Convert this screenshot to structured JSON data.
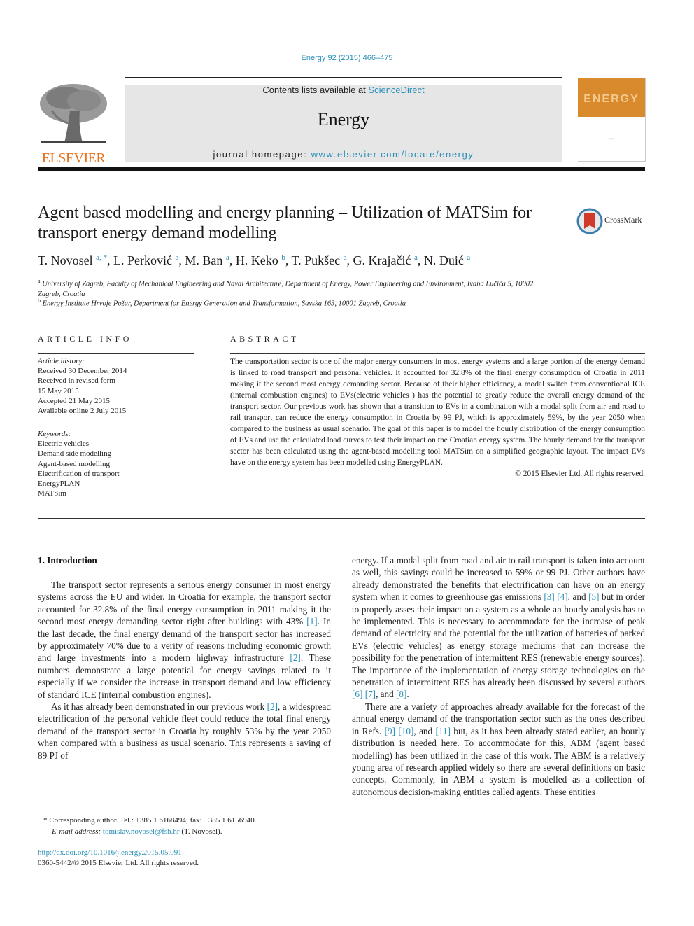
{
  "journal_citation": "Energy 92 (2015) 466–475",
  "header": {
    "publisher_logo_text": "ELSEVIER",
    "contents_prefix": "Contents lists available at ",
    "contents_link": "ScienceDirect",
    "journal_name": "Energy",
    "homepage_prefix": "journal homepage: ",
    "homepage_link": "www.elsevier.com/locate/energy",
    "cover_title": "ENERGY",
    "brand_color": "#e8731e",
    "link_color": "#2a8fb8",
    "cover_color": "#d98a2c"
  },
  "article": {
    "title": "Agent based modelling and energy planning – Utilization of MATSim for transport energy demand modelling",
    "crossmark_label": "CrossMark",
    "authors": [
      {
        "name": "T. Novosel",
        "aff": "a, *"
      },
      {
        "name": "L. Perković",
        "aff": "a"
      },
      {
        "name": "M. Ban",
        "aff": "a"
      },
      {
        "name": "H. Keko",
        "aff": "b"
      },
      {
        "name": "T. Pukšec",
        "aff": "a"
      },
      {
        "name": "G. Krajačić",
        "aff": "a"
      },
      {
        "name": "N. Duić",
        "aff": "a"
      }
    ],
    "affiliations": [
      {
        "mark": "a",
        "text": "University of Zagreb, Faculty of Mechanical Engineering and Naval Architecture, Department of Energy, Power Engineering and Environment, Ivana Lučića 5, 10002 Zagreb, Croatia"
      },
      {
        "mark": "b",
        "text": "Energy Institute Hrvoje Požar, Department for Energy Generation and Transformation, Savska 163, 10001 Zagreb, Croatia"
      }
    ]
  },
  "article_info": {
    "heading": "ARTICLE INFO",
    "history_label": "Article history:",
    "history": [
      "Received 30 December 2014",
      "Received in revised form",
      "15 May 2015",
      "Accepted 21 May 2015",
      "Available online 2 July 2015"
    ],
    "keywords_label": "Keywords:",
    "keywords": [
      "Electric vehicles",
      "Demand side modelling",
      "Agent-based modelling",
      "Electrification of transport",
      "EnergyPLAN",
      "MATSim"
    ]
  },
  "abstract": {
    "heading": "ABSTRACT",
    "text": "The transportation sector is one of the major energy consumers in most energy systems and a large portion of the energy demand is linked to road transport and personal vehicles. It accounted for 32.8% of the final energy consumption of Croatia in 2011 making it the second most energy demanding sector. Because of their higher efficiency, a modal switch from conventional ICE (internal combustion engines) to EVs(electric vehicles ) has the potential to greatly reduce the overall energy demand of the transport sector. Our previous work has shown that a transition to EVs in a combination with a modal split from air and road to rail transport can reduce the energy consumption in Croatia by 99 PJ, which is approximately 59%, by the year 2050 when compared to the business as usual scenario. The goal of this paper is to model the hourly distribution of the energy consumption of EVs and use the calculated load curves to test their impact on the Croatian energy system. The hourly demand for the transport sector has been calculated using the agent-based modelling tool MATSim on a simplified geographic layout. The impact EVs have on the energy system has been modelled using EnergyPLAN.",
    "copyright": "© 2015 Elsevier Ltd. All rights reserved."
  },
  "introduction": {
    "heading": "1.  Introduction",
    "p1": [
      "The transport sector represents a serious energy consumer in most energy systems across the EU and wider. In Croatia for example, the transport sector accounted for 32.8% of the final energy consumption in 2011 making it the second most energy demanding sector right after buildings with 43% ",
      "[1]",
      ". In the last decade, the final energy demand of the transport sector has increased by approximately 70% due to a verity of reasons including economic growth and large investments into a modern highway infrastructure ",
      "[2]",
      ". These numbers demonstrate a large potential for energy savings related to it especially if we consider the increase in transport demand and low efficiency of standard ICE (internal combustion engines)."
    ],
    "p2": [
      "As it has already been demonstrated in our previous work ",
      "[2]",
      ", a widespread electrification of the personal vehicle fleet could reduce the total final energy demand of the transport sector in Croatia by roughly 53% by the year 2050 when compared with a business as usual scenario. This represents a saving of 89 PJ of"
    ],
    "p3": [
      "energy. If a modal split from road and air to rail transport is taken into account as well, this savings could be increased to 59% or 99 PJ. Other authors have already demonstrated the benefits that electrification can have on an energy system when it comes to greenhouse gas emissions ",
      "[3]",
      " ",
      "[4]",
      ", and ",
      "[5]",
      " but in order to properly asses their impact on a system as a whole an hourly analysis has to be implemented. This is necessary to accommodate for the increase of peak demand of electricity and the potential for the utilization of batteries of parked EVs (electric vehicles) as energy storage mediums that can increase the possibility for the penetration of intermittent RES (renewable energy sources). The importance of the implementation of energy storage technologies on the penetration of intermittent RES has already been discussed by several authors ",
      "[6]",
      " ",
      "[7]",
      ", and ",
      "[8]",
      "."
    ],
    "p4": [
      "There are a variety of approaches already available for the forecast of the annual energy demand of the transportation sector such as the ones described in Refs. ",
      "[9]",
      " ",
      "[10]",
      ", and ",
      "[11]",
      " but, as it has been already stated earlier, an hourly distribution is needed here. To accommodate for this, ABM (agent based modelling) has been utilized in the case of this work. The ABM is a relatively young area of research applied widely so there are several definitions on basic concepts. Commonly, in ABM a system is modelled as a collection of autonomous decision-making entities called agents. These entities"
    ]
  },
  "footnote": {
    "marker": "*",
    "corresponding": "Corresponding author. Tel.: +385 1 6168494; fax: +385 1 6156940.",
    "email_label": "E-mail address:",
    "email": "tomislav.novosel@fsb.hr",
    "email_suffix": " (T. Novosel)."
  },
  "doi": {
    "url": "http://dx.doi.org/10.1016/j.energy.2015.05.091",
    "issn_line": "0360-5442/© 2015 Elsevier Ltd. All rights reserved."
  }
}
